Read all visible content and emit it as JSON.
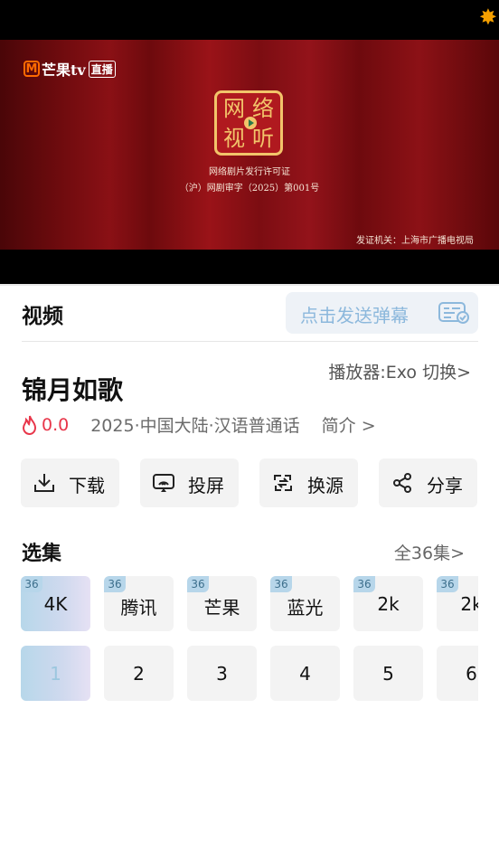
{
  "player": {
    "logo_text": "芒果tv",
    "logo_badge": "直播",
    "seal_chars": [
      "网",
      "络",
      "视",
      "听"
    ],
    "license_line1": "网络剧片发行许可证",
    "license_line2": "（沪）网剧审字（2025）第001号",
    "authority": "发证机关：上海市广播电视局"
  },
  "header": {
    "tab_label": "视频",
    "danmu_placeholder": "点击发送弹幕"
  },
  "show": {
    "title": "锦月如歌",
    "player_switch": "播放器:Exo 切换>",
    "score": "0.0",
    "meta": "2025·中国大陆·汉语普通话",
    "intro": "简介 >"
  },
  "actions": [
    {
      "label": "下载",
      "icon": "download-icon"
    },
    {
      "label": "投屏",
      "icon": "cast-icon"
    },
    {
      "label": "换源",
      "icon": "switch-source-icon"
    },
    {
      "label": "分享",
      "icon": "share-icon"
    }
  ],
  "episodes_section": {
    "title": "选集",
    "all_label": "全36集>"
  },
  "sources": [
    {
      "name": "4K",
      "count": "36"
    },
    {
      "name": "腾讯",
      "count": "36"
    },
    {
      "name": "芒果",
      "count": "36"
    },
    {
      "name": "蓝光",
      "count": "36"
    },
    {
      "name": "2k",
      "count": "36"
    },
    {
      "name": "2k",
      "count": "36"
    }
  ],
  "episodes": [
    "1",
    "2",
    "3",
    "4",
    "5",
    "6"
  ],
  "colors": {
    "accent": "#e8364a",
    "selected_start": "#b7d7ea",
    "selected_end": "#e6e1f4",
    "danmu_text": "#8cb8dc"
  }
}
